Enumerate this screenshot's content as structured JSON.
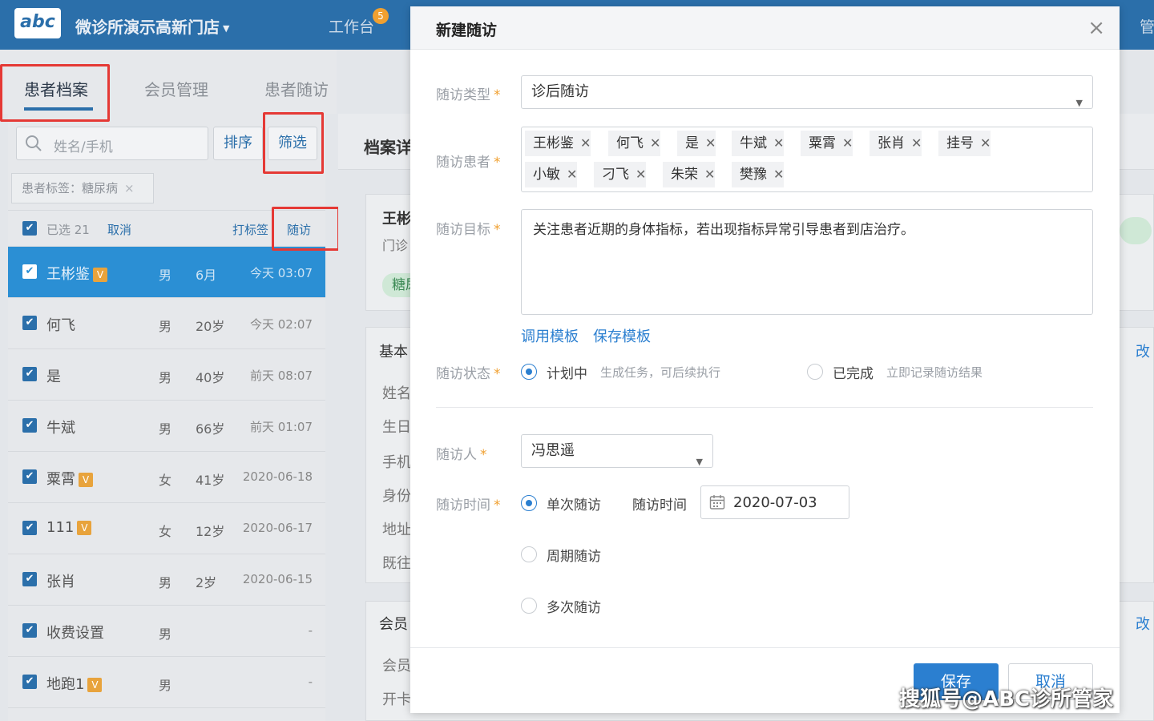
{
  "topbar": {
    "logo": "abc",
    "clinic_name": "微诊所演示高新门店",
    "workbench": "工作台",
    "workbench_badge": "5",
    "right_label": "管"
  },
  "tabs": [
    "患者档案",
    "会员管理",
    "患者随访"
  ],
  "search": {
    "placeholder": "姓名/手机"
  },
  "toolbar": {
    "sort": "排序",
    "filter": "筛选"
  },
  "filter_chip": {
    "label": "患者标签：糖尿病",
    "close": "×"
  },
  "selection": {
    "selected": "已选 21",
    "cancel": "取消",
    "tag": "打标签",
    "followup": "随访"
  },
  "patients": [
    {
      "name": "王彬鉴",
      "vip": true,
      "gender": "男",
      "age": "6月",
      "time": "今天 03:07"
    },
    {
      "name": "何飞",
      "vip": false,
      "gender": "男",
      "age": "20岁",
      "time": "今天 02:07"
    },
    {
      "name": "是",
      "vip": false,
      "gender": "男",
      "age": "40岁",
      "time": "前天 08:07"
    },
    {
      "name": "牛斌",
      "vip": false,
      "gender": "男",
      "age": "66岁",
      "time": "前天 01:07"
    },
    {
      "name": "粟霄",
      "vip": true,
      "gender": "女",
      "age": "41岁",
      "time": "2020-06-18"
    },
    {
      "name": "111",
      "vip": true,
      "gender": "女",
      "age": "12岁",
      "time": "2020-06-17"
    },
    {
      "name": "张肖",
      "vip": false,
      "gender": "男",
      "age": "2岁",
      "time": "2020-06-15"
    },
    {
      "name": "收费设置",
      "vip": false,
      "gender": "男",
      "age": "",
      "time": "-"
    },
    {
      "name": "地跑1",
      "vip": true,
      "gender": "男",
      "age": "",
      "time": "-"
    }
  ],
  "vip_mark": "V",
  "middle": {
    "title": "档案详",
    "patient_name": "王彬",
    "clinic": "门诊",
    "tag": "糖尿",
    "section_basic": "基本",
    "fields": [
      "姓名",
      "生日",
      "手机",
      "身份",
      "地址",
      "既往"
    ],
    "edit": "改",
    "section_member": "会员",
    "member_fields": [
      "会员",
      "开卡"
    ]
  },
  "modal": {
    "title": "新建随访",
    "close": "×",
    "type_label": "随访类型",
    "type_value": "诊后随访",
    "patients_label": "随访患者",
    "patient_tags": [
      "王彬鉴",
      "何飞",
      "是",
      "牛斌",
      "粟霄",
      "张肖",
      "挂号",
      "小敏",
      "刁飞",
      "朱荣",
      "樊豫"
    ],
    "goal_label": "随访目标",
    "goal_text": "关注患者近期的身体指标，若出现指标异常引导患者到店治疗。",
    "use_template": "调用模板",
    "save_template": "保存模板",
    "status_label": "随访状态",
    "status_planned": "计划中",
    "status_planned_hint": "生成任务，可后续执行",
    "status_done": "已完成",
    "status_done_hint": "立即记录随访结果",
    "person_label": "随访人",
    "person_value": "冯思遥",
    "time_label": "随访时间",
    "mode_single": "单次随访",
    "time_sub_label": "随访时间",
    "date": "2020-07-03",
    "mode_periodic": "周期随访",
    "mode_multiple": "多次随访",
    "save": "保存",
    "cancel": "取消",
    "required_mark": "*"
  },
  "watermark": "搜狐号@ABC诊所管家",
  "colors": {
    "brand": "#2b6faa",
    "accent": "#2b7fd0",
    "highlight": "#e53935",
    "vip": "#e8a33c"
  }
}
